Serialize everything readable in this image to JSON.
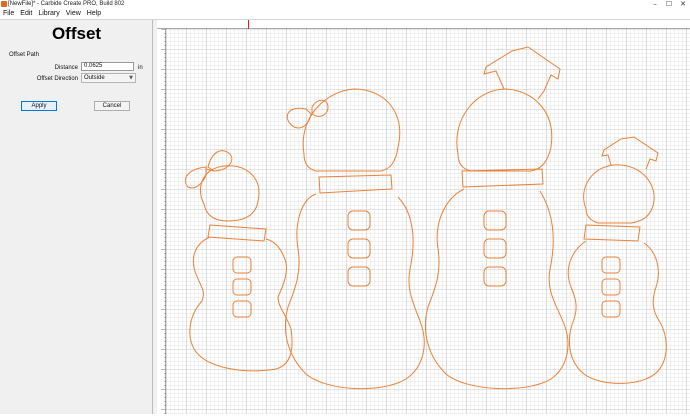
{
  "window": {
    "title": "[NewFile]* - Carbide Create PRO, Build 802",
    "minimize_glyph": "–",
    "maximize_glyph": "☐",
    "close_glyph": "✕"
  },
  "menu": {
    "items": [
      {
        "label": "File"
      },
      {
        "label": "Edit"
      },
      {
        "label": "Library"
      },
      {
        "label": "View"
      },
      {
        "label": "Help"
      }
    ]
  },
  "panel": {
    "title": "Offset",
    "section_label": "Offset Path",
    "distance_label": "Distance",
    "distance_value": "0.0625",
    "distance_unit": "in",
    "direction_label": "Offset Direction",
    "direction_value": "Outside",
    "apply_label": "Apply",
    "cancel_label": "Cancel"
  },
  "colors": {
    "path_stroke": "#e8833a",
    "grid_minor": "#e4e4e4",
    "grid_major": "#c9c9c9",
    "accent": "#0078d7",
    "ruler_marker": "#e02020"
  },
  "icons": {
    "app": "carbide-create-icon",
    "dropdown": "chevron-down-icon"
  }
}
